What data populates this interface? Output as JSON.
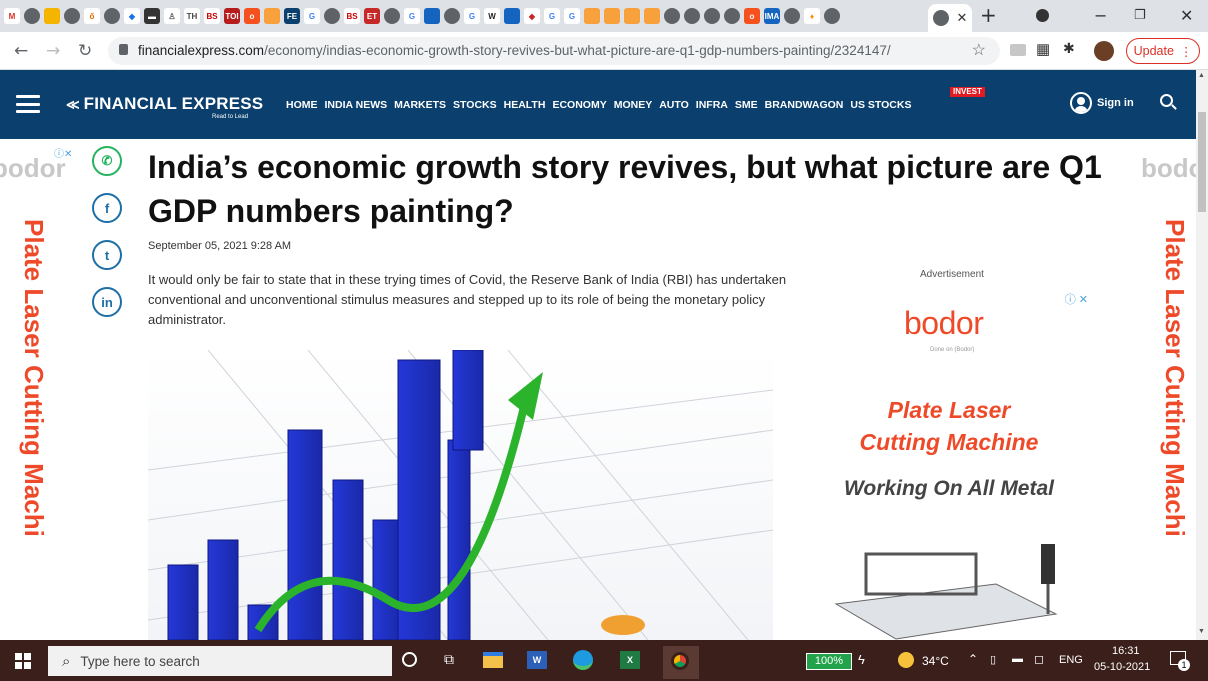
{
  "browser": {
    "tab_icons": [
      {
        "name": "gmail-icon",
        "glyph": "M",
        "bg": "#ffffff",
        "fg": "#d93025"
      },
      {
        "name": "globe-icon",
        "glyph": "",
        "bg": "gray",
        "fg": "#fff"
      },
      {
        "name": "drive-icon",
        "glyph": "",
        "bg": "#f4b400",
        "fg": "#fff"
      },
      {
        "name": "globe-icon",
        "glyph": "",
        "bg": "gray",
        "fg": "#fff"
      },
      {
        "name": "fork-icon",
        "glyph": "ő",
        "bg": "#ffffff",
        "fg": "#e06c00"
      },
      {
        "name": "globe-icon",
        "glyph": "",
        "bg": "gray",
        "fg": "#fff"
      },
      {
        "name": "diamond-icon",
        "glyph": "◆",
        "bg": "#ffffff",
        "fg": "#1a73e8"
      },
      {
        "name": "screen-icon",
        "glyph": "▬",
        "bg": "#333333",
        "fg": "#fff"
      },
      {
        "name": "people-icon",
        "glyph": "♙",
        "bg": "#ffffff",
        "fg": "#555"
      },
      {
        "name": "th-icon",
        "glyph": "TH",
        "bg": "#ffffff",
        "fg": "#444"
      },
      {
        "name": "bs-icon",
        "glyph": "BS",
        "bg": "#ffffff",
        "fg": "#c00"
      },
      {
        "name": "toi-icon",
        "glyph": "TOI",
        "bg": "#b71c1c",
        "fg": "#fff"
      },
      {
        "name": "circle-icon",
        "glyph": "o",
        "bg": "#f4511e",
        "fg": "#fff"
      },
      {
        "name": "circle-icon",
        "glyph": "",
        "bg": "#f8a13c",
        "fg": "#fff"
      },
      {
        "name": "fe-icon",
        "glyph": "FE",
        "bg": "#0a3f6e",
        "fg": "#fff"
      },
      {
        "name": "google-icon",
        "glyph": "G",
        "bg": "#ffffff",
        "fg": "#4285f4"
      },
      {
        "name": "globe-icon",
        "glyph": "",
        "bg": "gray",
        "fg": "#fff"
      },
      {
        "name": "bs-icon",
        "glyph": "BS",
        "bg": "#ffffff",
        "fg": "#c00"
      },
      {
        "name": "et-icon",
        "glyph": "ET",
        "bg": "#c62828",
        "fg": "#fff"
      },
      {
        "name": "globe-icon",
        "glyph": "",
        "bg": "gray",
        "fg": "#fff"
      },
      {
        "name": "google-icon",
        "glyph": "G",
        "bg": "#ffffff",
        "fg": "#4285f4"
      },
      {
        "name": "circle-icon",
        "glyph": "",
        "bg": "#1565c0",
        "fg": "#fff"
      },
      {
        "name": "globe-icon",
        "glyph": "",
        "bg": "gray",
        "fg": "#fff"
      },
      {
        "name": "google-icon",
        "glyph": "G",
        "bg": "#ffffff",
        "fg": "#4285f4"
      },
      {
        "name": "wikipedia-icon",
        "glyph": "W",
        "bg": "#ffffff",
        "fg": "#222"
      },
      {
        "name": "circle-icon",
        "glyph": "",
        "bg": "#1565c0",
        "fg": "#fff"
      },
      {
        "name": "diamond-icon",
        "glyph": "◆",
        "bg": "#ffffff",
        "fg": "#c62828"
      },
      {
        "name": "google-icon",
        "glyph": "G",
        "bg": "#ffffff",
        "fg": "#4285f4"
      },
      {
        "name": "google-icon",
        "glyph": "G",
        "bg": "#ffffff",
        "fg": "#4285f4"
      },
      {
        "name": "circle-icon",
        "glyph": "",
        "bg": "#f8a13c",
        "fg": "#fff"
      },
      {
        "name": "circle-icon",
        "glyph": "",
        "bg": "#f8a13c",
        "fg": "#fff"
      },
      {
        "name": "circle-icon",
        "glyph": "",
        "bg": "#f8a13c",
        "fg": "#fff"
      },
      {
        "name": "circle-icon",
        "glyph": "",
        "bg": "#f8a13c",
        "fg": "#fff"
      },
      {
        "name": "globe-icon",
        "glyph": "",
        "bg": "gray",
        "fg": "#fff"
      },
      {
        "name": "globe-icon",
        "glyph": "",
        "bg": "gray",
        "fg": "#fff"
      },
      {
        "name": "globe-icon",
        "glyph": "",
        "bg": "gray",
        "fg": "#fff"
      },
      {
        "name": "globe-icon",
        "glyph": "",
        "bg": "gray",
        "fg": "#fff"
      },
      {
        "name": "circle-icon",
        "glyph": "o",
        "bg": "#f4511e",
        "fg": "#fff"
      },
      {
        "name": "ima-icon",
        "glyph": "IMA",
        "bg": "#1565c0",
        "fg": "#fff"
      },
      {
        "name": "globe-icon",
        "glyph": "",
        "bg": "gray",
        "fg": "#fff"
      },
      {
        "name": "leaf-icon",
        "glyph": "♦",
        "bg": "#ffffff",
        "fg": "#fb8c00"
      },
      {
        "name": "globe-icon",
        "glyph": "",
        "bg": "gray",
        "fg": "#fff"
      }
    ],
    "url_host": "financialexpress.com",
    "url_path": "/economy/indias-economic-growth-story-revives-but-what-picture-are-q1-gdp-numbers-painting/2324147/",
    "update_label": "Update"
  },
  "site": {
    "logo": "FINANCIAL EXPRESS",
    "tagline": "Read to Lead",
    "menu": [
      "HOME",
      "INDIA NEWS",
      "MARKETS",
      "STOCKS",
      "HEALTH",
      "ECONOMY",
      "MONEY",
      "AUTO",
      "INFRA",
      "SME",
      "BRANDWAGON",
      "US STOCKS"
    ],
    "invest_badge": "INVEST",
    "signin": "Sign in",
    "nav_color": "#0a3f6e"
  },
  "side_ad": {
    "logo": "bodor",
    "text": "Plate Laser Cutting Machi"
  },
  "article": {
    "headline": "India’s economic growth story revives, but what picture are Q1 GDP numbers painting?",
    "date": "September 05, 2021 9:28 AM",
    "intro": "It would only be fair to state that in these trying times of Covid, the Reserve Bank of India (RBI) has undertaken conventional and unconventional stimulus measures and stepped up to its role of being the monetary policy administrator."
  },
  "ad": {
    "label": "Advertisement",
    "brand": "bodor",
    "brand_sub": "Done on (Bodor)",
    "line1": "Plate Laser",
    "line2": "Cutting Machine",
    "line3": "Working On All Metal",
    "accent": "#ee4a2a"
  },
  "taskbar": {
    "search_placeholder": "Type here to search",
    "battery": "100%",
    "temperature": "34°C",
    "language": "ENG",
    "time": "16:31",
    "date": "05-10-2021",
    "notification_count": "1"
  }
}
